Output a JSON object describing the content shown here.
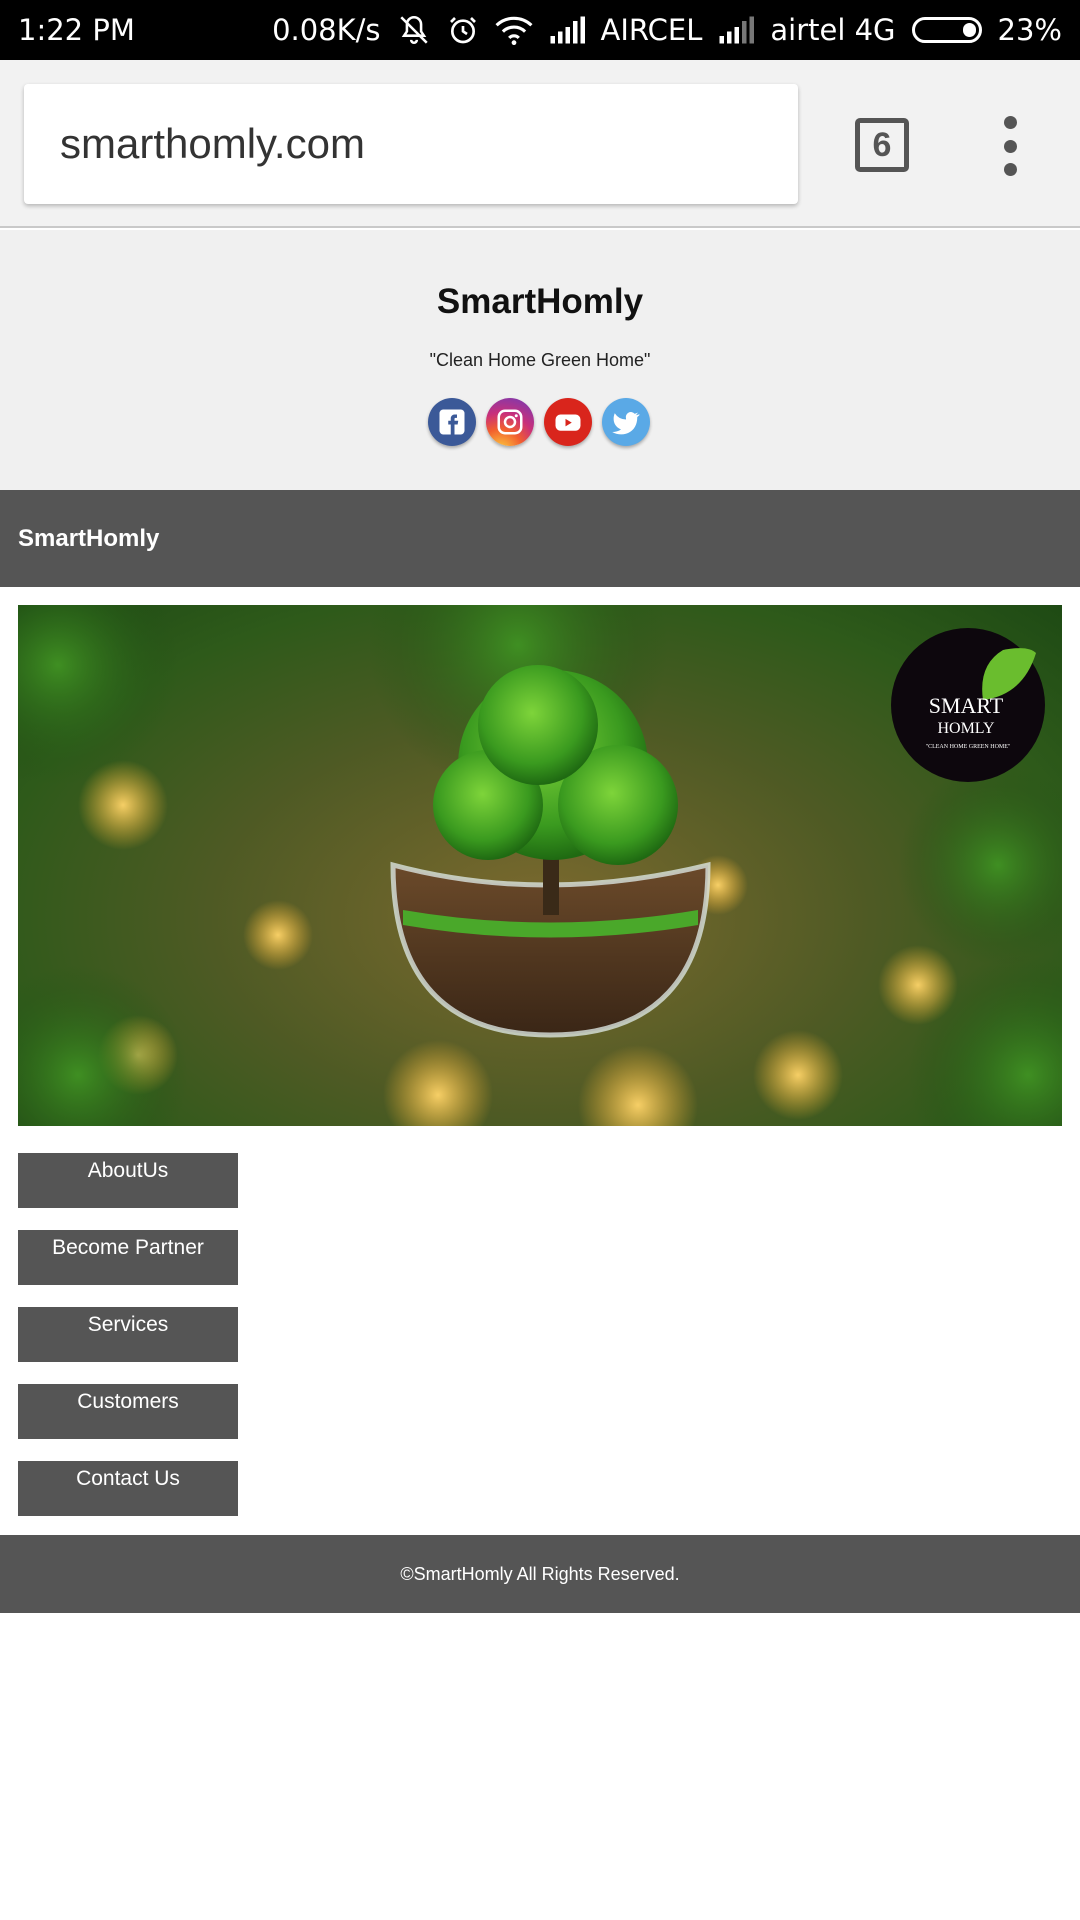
{
  "status_bar": {
    "time": "1:22 PM",
    "speed": "0.08K/s",
    "carrier1": "AIRCEL",
    "carrier2": "airtel 4G",
    "battery": "23%",
    "battery_level": 0.23,
    "icons": [
      "mute-bell-icon",
      "alarm-icon",
      "wifi-icon",
      "signal-icon",
      "signal-icon",
      "battery-icon"
    ]
  },
  "browser": {
    "url": "smarthomly.com",
    "tab_count": "6"
  },
  "header": {
    "title": "SmartHomly",
    "tagline": "\"Clean Home Green Home\"",
    "social": [
      "facebook-icon",
      "instagram-icon",
      "youtube-icon",
      "twitter-icon"
    ]
  },
  "nav": {
    "brand": "SmartHomly"
  },
  "hero": {
    "logo_text_top": "SMART",
    "logo_text_bottom": "HOMLY",
    "logo_caption": "\"CLEAN HOME GREEN HOME\""
  },
  "menu": {
    "items": [
      {
        "label": "AboutUs"
      },
      {
        "label": "Become Partner"
      },
      {
        "label": "Services"
      },
      {
        "label": "Customers"
      },
      {
        "label": "Contact Us"
      }
    ]
  },
  "footer": {
    "text": "©SmartHomly All Rights Reserved."
  },
  "colors": {
    "nav_bg": "#555555",
    "header_bg": "#f0f0f0",
    "status_bg": "#000000"
  }
}
